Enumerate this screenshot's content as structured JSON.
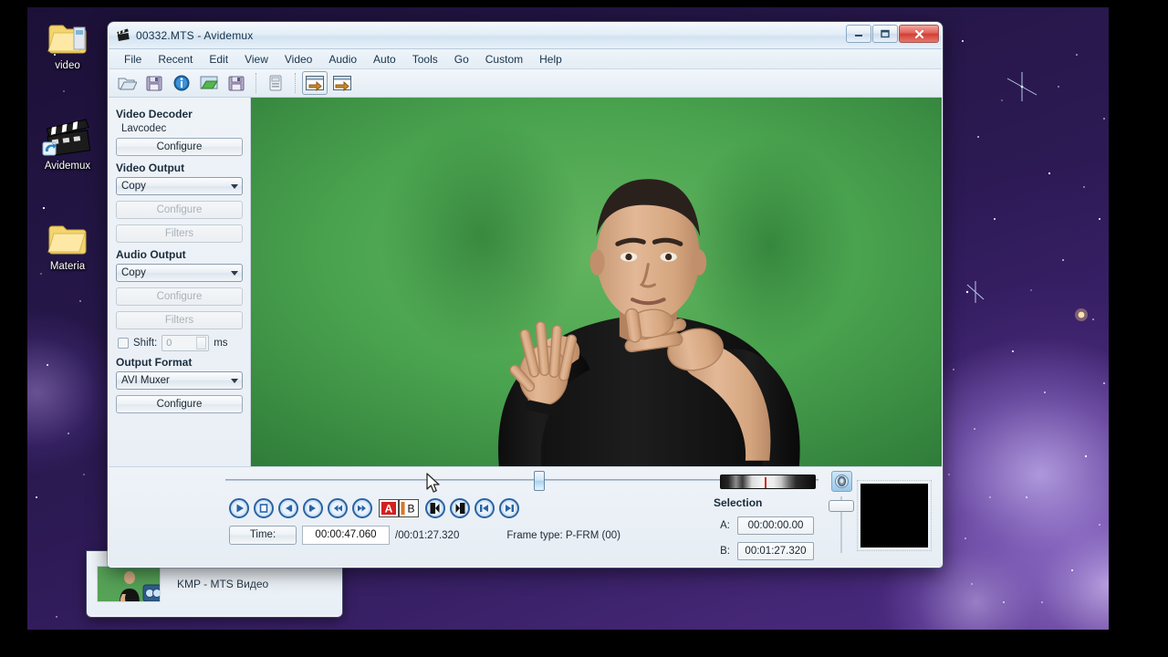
{
  "desktop": {
    "icons": [
      {
        "name": "video-folder",
        "label": "video",
        "glyph": "folder"
      },
      {
        "name": "avidemux-shortcut",
        "label": "Avidemux",
        "glyph": "clapper"
      },
      {
        "name": "materials-folder",
        "label": "Materia",
        "glyph": "folder"
      }
    ],
    "wallpaper_colors": {
      "deep": "#1b1036",
      "mid": "#3a2168",
      "nebula": "#b9a6e8"
    }
  },
  "window": {
    "title": "00332.MTS - Avidemux",
    "icon": "avidemux-icon",
    "controls": {
      "minimize": "minimize-button",
      "maximize": "maximize-button",
      "close": "close-button"
    }
  },
  "menubar": {
    "items": [
      "File",
      "Recent",
      "Edit",
      "View",
      "Video",
      "Audio",
      "Auto",
      "Tools",
      "Go",
      "Custom",
      "Help"
    ]
  },
  "toolbar": {
    "buttons": [
      {
        "name": "open-file-button",
        "icon": "open-folder-icon",
        "framed": false
      },
      {
        "name": "save-file-button",
        "icon": "floppy-save-icon",
        "framed": false
      },
      {
        "name": "file-info-button",
        "icon": "info-circle-icon",
        "framed": false
      },
      {
        "name": "open-video-button",
        "icon": "open-video-icon",
        "framed": false
      },
      {
        "name": "save-video-button",
        "icon": "save-video-icon",
        "framed": false
      },
      {
        "name": "calculator-button",
        "icon": "calculator-icon",
        "framed": false
      },
      {
        "name": "jump-marker-a-button",
        "icon": "arrow-into-frame-icon",
        "framed": true
      },
      {
        "name": "jump-marker-b-button",
        "icon": "arrow-out-frame-icon",
        "framed": false
      }
    ]
  },
  "left_panel": {
    "video_decoder": {
      "title": "Video Decoder",
      "codec": "Lavcodec",
      "configure_label": "Configure"
    },
    "video_output": {
      "title": "Video Output",
      "selected": "Copy",
      "configure_label": "Configure",
      "filters_label": "Filters",
      "configure_enabled": false,
      "filters_enabled": false
    },
    "audio_output": {
      "title": "Audio Output",
      "selected": "Copy",
      "configure_label": "Configure",
      "filters_label": "Filters",
      "configure_enabled": false,
      "filters_enabled": false,
      "shift_label": "Shift:",
      "shift_value": "0",
      "shift_checked": false,
      "shift_units": "ms"
    },
    "output_format": {
      "title": "Output Format",
      "selected": "AVI Muxer",
      "configure_label": "Configure"
    }
  },
  "preview": {
    "description": "green-screen video frame of a man gesturing",
    "background_color": "#3f9a4a"
  },
  "transport": {
    "buttons": [
      {
        "name": "play-button",
        "icon": "play-icon"
      },
      {
        "name": "stop-button",
        "icon": "stop-icon"
      },
      {
        "name": "prev-frame-button",
        "icon": "arrow-left-icon"
      },
      {
        "name": "next-frame-button",
        "icon": "arrow-right-icon"
      },
      {
        "name": "rewind-button",
        "icon": "double-arrow-left-icon"
      },
      {
        "name": "forward-button",
        "icon": "double-arrow-right-icon"
      },
      {
        "name": "set-marker-a-button",
        "icon": "marker-a-icon",
        "label": "A"
      },
      {
        "name": "set-marker-b-button",
        "icon": "marker-b-icon",
        "label": "B"
      },
      {
        "name": "prev-black-frame-button",
        "icon": "black-frame-left-icon"
      },
      {
        "name": "next-black-frame-button",
        "icon": "black-frame-right-icon"
      },
      {
        "name": "go-to-start-button",
        "icon": "skip-to-start-icon"
      },
      {
        "name": "go-to-end-button",
        "icon": "skip-to-end-icon"
      }
    ],
    "time_button_label": "Time:",
    "current_time": "00:00:47.060",
    "total_time": "/00:01:27.320",
    "frame_type_label": "Frame type:",
    "frame_type_value": "P-FRM (00)",
    "frame_type_full": "Frame type:  P-FRM (00)",
    "slider_position_percent": 52
  },
  "selection": {
    "title": "Selection",
    "a_label": "A:",
    "a_value": "00:00:00.00",
    "b_label": "B:",
    "b_value": "00:01:27.320",
    "volume_icon": "volume-speaker-icon",
    "vu_meter": "audio-level-meter"
  },
  "taskbar_window": {
    "label": "KMP - MTS Видео",
    "thumbnail": "kmp-video-thumbnail"
  }
}
